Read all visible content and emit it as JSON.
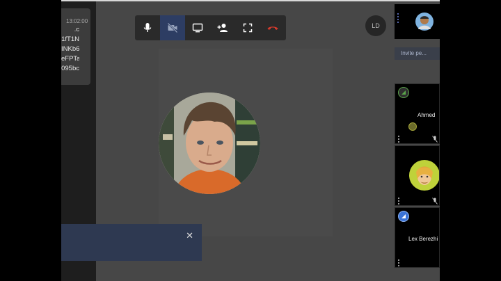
{
  "chat": {
    "time": "13:02:00",
    "lines": [
      ".c",
      "1fT1N",
      "INKb6",
      "eFPTa",
      "095bc"
    ]
  },
  "toolbar": {
    "buttons": [
      {
        "name": "microphone",
        "active": false
      },
      {
        "name": "camera-off",
        "active": true
      },
      {
        "name": "share-screen",
        "active": false
      },
      {
        "name": "add-participant",
        "active": false
      },
      {
        "name": "fullscreen",
        "active": false
      },
      {
        "name": "hang-up",
        "active": false
      }
    ]
  },
  "me": {
    "initials": "LD"
  },
  "sidebar": {
    "invite_label": "Invite pe...",
    "participants": [
      {
        "name": "Ahmed"
      },
      {
        "name": ""
      },
      {
        "name": "Lex Berezhi"
      }
    ]
  },
  "colors": {
    "accent": "#2d3d63",
    "hangup": "#d33a2c",
    "badge_green": "#5aa64a",
    "badge_blue": "#3a73d6"
  }
}
